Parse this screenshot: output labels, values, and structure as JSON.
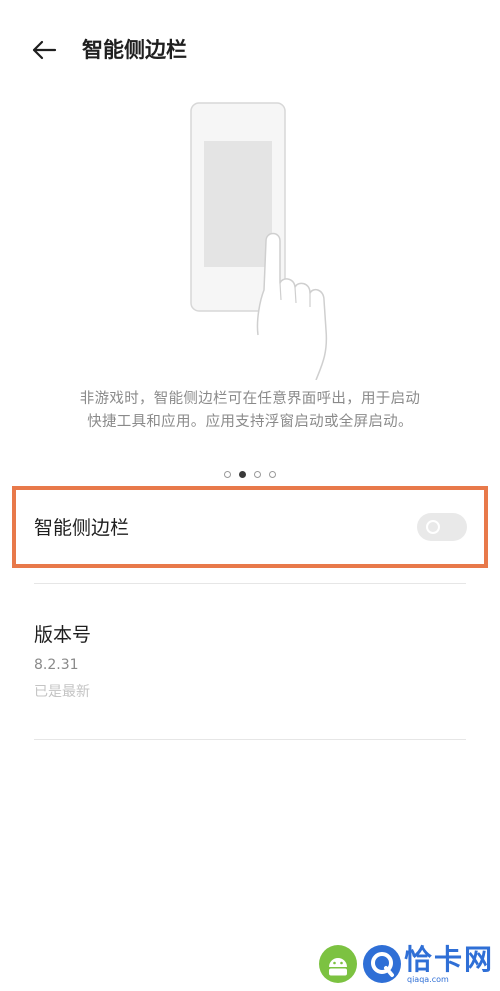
{
  "header": {
    "title": "智能侧边栏",
    "back_icon": "arrow-left-icon"
  },
  "intro": {
    "description_line1": "非游戏时，智能侧边栏可在任意界面呼出，用于启动",
    "description_line2": "快捷工具和应用。应用支持浮窗启动或全屏启动。",
    "carousel": {
      "page_count": 4,
      "active_index": 1
    }
  },
  "settings": {
    "sidebar_toggle": {
      "label": "智能侧边栏",
      "enabled": false
    },
    "version": {
      "title": "版本号",
      "value": "8.2.31",
      "status": "已是最新"
    }
  },
  "watermark": {
    "name": "恰卡网",
    "url": "qiaqa.com"
  },
  "colors": {
    "highlight": "#e8794a",
    "toggle_off": "#e9e9e9",
    "watermark_blue": "#2f6fd6",
    "watermark_green": "#7cc241"
  }
}
